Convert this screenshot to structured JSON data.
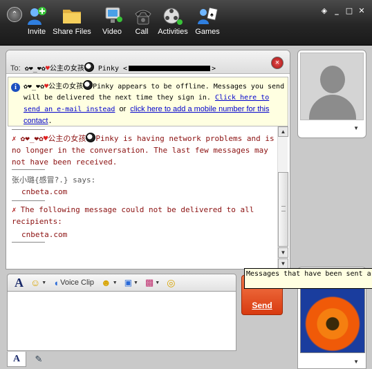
{
  "toolbar": {
    "menu_glyph": "⌃",
    "items": [
      {
        "label": "Invite",
        "icon": "invite-icon"
      },
      {
        "label": "Share Files",
        "icon": "folder-icon"
      },
      {
        "label": "Video",
        "icon": "video-icon"
      },
      {
        "label": "Call",
        "icon": "phone-icon"
      },
      {
        "label": "Activities",
        "icon": "activities-icon"
      },
      {
        "label": "Games",
        "icon": "games-icon"
      }
    ],
    "window": {
      "minimize": "_",
      "maximize": "□",
      "close": "✕"
    }
  },
  "conversation": {
    "to_label": "To:",
    "contact_prefix": "✿❤_❤✿",
    "contact_name": "公主の女孩",
    "contact_suffix": "Pinky <",
    "contact_tail": ">",
    "offline_notice": {
      "pre": "Pinky appears to be offline. Messages you send will be delivered the next time they sign in.",
      "email_link": "Click here to send an e-mail instead",
      "or": "or",
      "mobile_link": "click here to add a mobile number for this contact",
      "end": "."
    },
    "messages": [
      {
        "type": "system",
        "text": "Pinky is having network problems and is no longer in the conversation.  The last few messages may not have been received."
      },
      {
        "type": "user",
        "sender": "张小璐{感冒?.} says:",
        "text": "cnbeta.com"
      },
      {
        "type": "system",
        "text": "The following message could not be delivered to all recipients:"
      },
      {
        "type": "undelivered",
        "text": "cnbeta.com"
      }
    ]
  },
  "compose": {
    "voice_clip_label": "Voice Clip",
    "send_label": "Send",
    "tooltip": "Messages that have been sent ar received."
  },
  "colors": {
    "system_text": "#8b1010",
    "link": "#0000cc",
    "send": "#e8521e"
  }
}
